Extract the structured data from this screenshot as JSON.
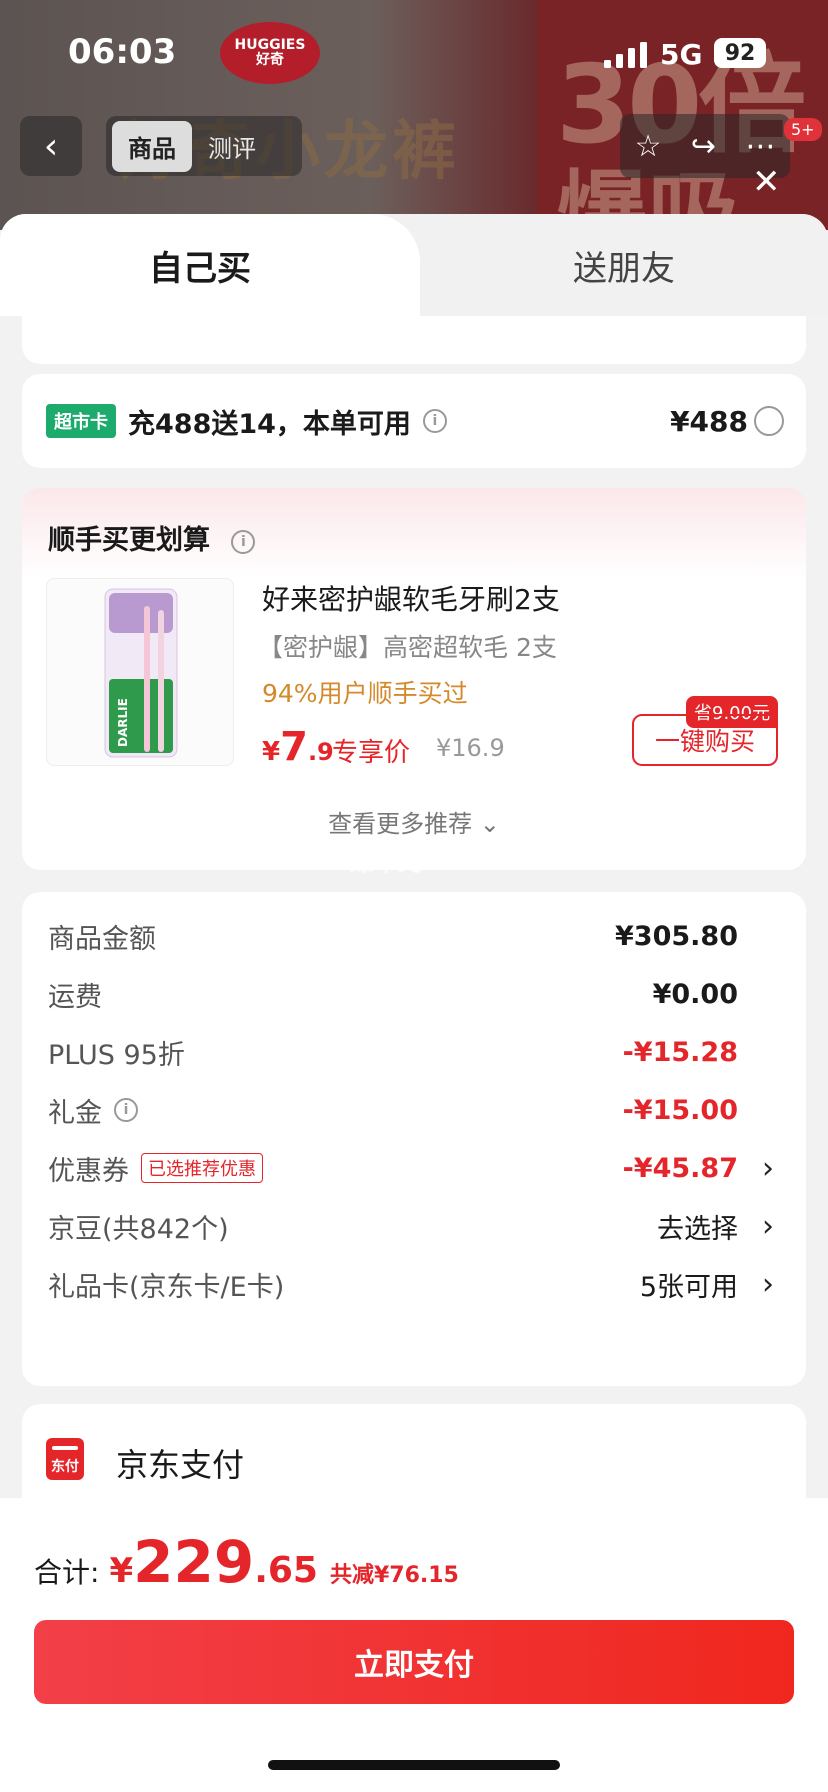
{
  "status": {
    "time": "06:03",
    "network": "5G",
    "battery": "92"
  },
  "background": {
    "logo": "HUGGIES",
    "logo_sub": "好奇",
    "banner_text": "好奇小龙裤",
    "promo_line1": "30倍",
    "promo_line2": "爆吸",
    "nav_tabs": [
      "商品",
      "测评"
    ],
    "notif_badge": "5+"
  },
  "tabs": {
    "self": "自己买",
    "friend": "送朋友"
  },
  "supermarket_card": {
    "badge": "超市卡",
    "text": "充488送14，本单可用",
    "price": "¥488"
  },
  "upsell": {
    "title": "顺手买更划算",
    "product": {
      "name": "好来密护龈软毛牙刷2支",
      "subtitle": "【密护龈】高密超软毛 2支",
      "bought_pct": "94%用户顺手买过",
      "price_currency": "¥",
      "price_int": "7",
      "price_dec": ".9",
      "price_label": "专享价",
      "original_price": "¥16.9",
      "save_tag": "省9.00元",
      "buy_button": "一键购买",
      "image_brand": "DARLIE"
    },
    "more": "查看更多推荐"
  },
  "watermark": "爆单光",
  "breakdown": {
    "rows": [
      {
        "label": "商品金额",
        "value": "¥305.80"
      },
      {
        "label": "运费",
        "value": "¥0.00"
      },
      {
        "label": "PLUS 95折",
        "value": "-¥15.28"
      },
      {
        "label": "礼金",
        "value": "-¥15.00"
      },
      {
        "label": "优惠券",
        "tag": "已选推荐优惠",
        "value": "-¥45.87"
      },
      {
        "label": "京豆(共842个)",
        "value": "去选择"
      },
      {
        "label": "礼品卡(京东卡/E卡)",
        "value": "5张可用"
      }
    ]
  },
  "payment": {
    "icon_text": "东付",
    "name": "京东支付"
  },
  "footer": {
    "total_label": "合计:",
    "currency": "¥",
    "total_int": "229",
    "total_dec": ".65",
    "saved": "共减¥76.15",
    "pay_button": "立即支付"
  },
  "colors": {
    "accent_red": "#e4262b",
    "badge_green": "#1dab6d",
    "orange_text": "#d4892a"
  }
}
